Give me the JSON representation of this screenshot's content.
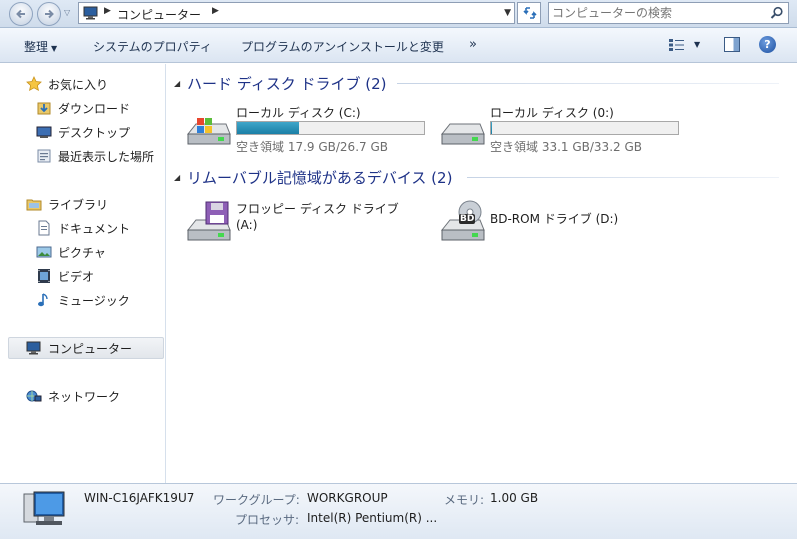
{
  "address_bar": {
    "crumb": "コンピューター",
    "search_placeholder": "コンピューターの検索"
  },
  "toolbar": {
    "organize": "整理",
    "system_properties": "システムのプロパティ",
    "uninstall": "プログラムのアンインストールと変更",
    "more": "»"
  },
  "nav": {
    "favorites": "お気に入り",
    "downloads": "ダウンロード",
    "desktop": "デスクトップ",
    "recent": "最近表示した場所",
    "libraries": "ライブラリ",
    "documents": "ドキュメント",
    "pictures": "ピクチャ",
    "videos": "ビデオ",
    "music": "ミュージック",
    "computer": "コンピューター",
    "network": "ネットワーク"
  },
  "groups": {
    "hard_disks": {
      "title": "ハード ディスク ドライブ (2)",
      "drives": [
        {
          "name": "ローカル ディスク (C:)",
          "free": "空き領域 17.9 GB/26.7 GB",
          "used_fraction": 0.33,
          "bar_color": "#1a7fa6"
        },
        {
          "name": "ローカル ディスク (0:)",
          "free": "空き領域 33.1 GB/33.2 GB",
          "used_fraction": 0.003,
          "bar_color": "#1a7fa6"
        }
      ]
    },
    "removable": {
      "title": "リムーバブル記憶域があるデバイス (2)",
      "drives": [
        {
          "name_line1": "フロッピー ディスク ドライブ",
          "name_line2": "(A:)",
          "icon": "floppy-drive-icon"
        },
        {
          "name": "BD-ROM ドライブ (D:)",
          "icon": "bd-rom-drive-icon",
          "badge": "BD"
        }
      ]
    }
  },
  "details": {
    "computer_name": "WIN-C16JAFK19U7",
    "workgroup_label": "ワークグループ:",
    "workgroup_value": "WORKGROUP",
    "memory_label": "メモリ:",
    "memory_value": "1.00 GB",
    "processor_label": "プロセッサ:",
    "processor_value": "Intel(R) Pentium(R) ..."
  }
}
